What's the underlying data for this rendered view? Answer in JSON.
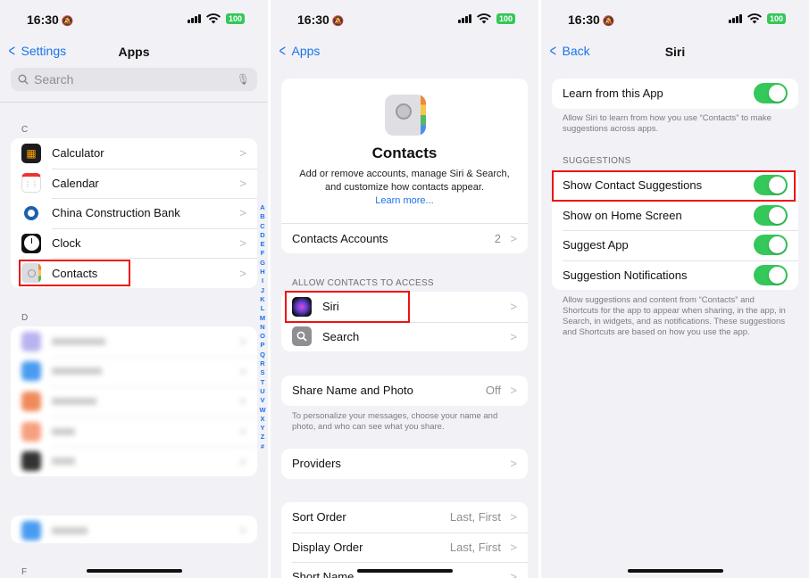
{
  "status": {
    "time": "16:30",
    "battery": "100"
  },
  "panel1": {
    "back_label": "Settings",
    "title": "Apps",
    "search_placeholder": "Search",
    "section_c": "C",
    "section_d": "D",
    "section_f": "F",
    "apps_c": [
      {
        "label": "Calculator",
        "icon": "calculator-icon"
      },
      {
        "label": "Calendar",
        "icon": "calendar-icon"
      },
      {
        "label": "China Construction Bank",
        "icon": "bank-icon"
      },
      {
        "label": "Clock",
        "icon": "clock-icon"
      },
      {
        "label": "Contacts",
        "icon": "contacts-icon"
      }
    ],
    "index_letters": [
      "A",
      "B",
      "C",
      "D",
      "E",
      "F",
      "G",
      "H",
      "I",
      "J",
      "K",
      "L",
      "M",
      "N",
      "O",
      "P",
      "Q",
      "R",
      "S",
      "T",
      "U",
      "V",
      "W",
      "X",
      "Y",
      "Z",
      "#"
    ]
  },
  "panel2": {
    "back_label": "Apps",
    "app_name": "Contacts",
    "description": "Add or remove accounts, manage Siri & Search, and customize how contacts appear.",
    "learn_more": "Learn more...",
    "accounts_label": "Contacts Accounts",
    "accounts_count": "2",
    "section_access": "ALLOW CONTACTS TO ACCESS",
    "access_items": [
      {
        "label": "Siri",
        "icon": "siri-icon"
      },
      {
        "label": "Search",
        "icon": "search-icon"
      }
    ],
    "share_label": "Share Name and Photo",
    "share_value": "Off",
    "share_footer": "To personalize your messages, choose your name and photo, and who can see what you share.",
    "providers_label": "Providers",
    "sort_order_label": "Sort Order",
    "sort_order_value": "Last, First",
    "display_order_label": "Display Order",
    "display_order_value": "Last, First",
    "short_name_label": "Short Name"
  },
  "panel3": {
    "back_label": "Back",
    "title": "Siri",
    "learn_label": "Learn from this App",
    "learn_footer": "Allow Siri to learn from how you use “Contacts” to make suggestions across apps.",
    "section_suggestions": "SUGGESTIONS",
    "suggestions": [
      {
        "label": "Show Contact Suggestions",
        "on": true
      },
      {
        "label": "Show on Home Screen",
        "on": true
      },
      {
        "label": "Suggest App",
        "on": true
      },
      {
        "label": "Suggestion Notifications",
        "on": true
      }
    ],
    "suggestions_footer": "Allow suggestions and content from “Contacts” and Shortcuts for the app to appear when sharing, in the app, in Search, in widgets, and as notifications. These suggestions and Shortcuts are based on how you use the app."
  },
  "colors": {
    "accent": "#1a73e8",
    "toggle_on": "#34c759",
    "highlight": "#ee1111"
  }
}
